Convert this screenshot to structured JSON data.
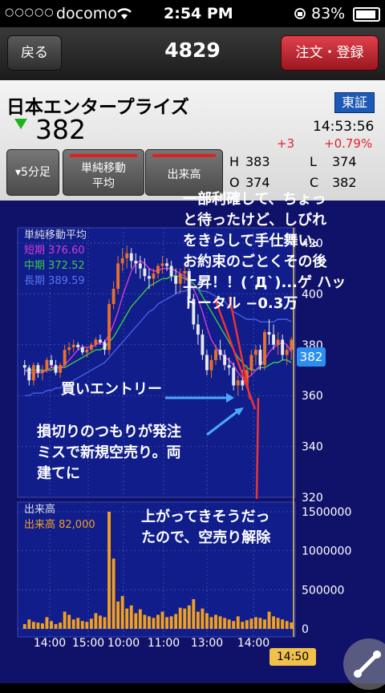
{
  "status_bar": {
    "signal": "○○○○○",
    "carrier": "docomo",
    "time": "2:54 PM",
    "battery": "83%"
  },
  "nav": {
    "back_label": "戻る",
    "title": "4829",
    "order_label": "注文・登録"
  },
  "stock": {
    "name": "日本エンタープライズ",
    "exchange": "東証",
    "price": "382",
    "time": "14:53:56",
    "change": "+3",
    "change_pct": "+0.79%"
  },
  "tabs": {
    "interval": "▾5分足",
    "sma_line1": "単純移動",
    "sma_line2": "平均",
    "volume": "出来高"
  },
  "ohlc": {
    "h_label": "H",
    "h": "383",
    "l_label": "L",
    "l": "374",
    "o_label": "O",
    "o": "374",
    "c_label": "C",
    "c": "382"
  },
  "legend": {
    "title": "単純移動平均",
    "short": "短期 376.60",
    "mid": "中期 372.52",
    "long": "長期 389.59",
    "vol_title": "出来高",
    "vol": "出来高 82,000"
  },
  "colors": {
    "bg": "#10126a",
    "up": "#e8702a",
    "down": "#e8e8e8",
    "short": "#d93ad9",
    "mid": "#3ec94a",
    "long": "#4a5ee0",
    "volume": "#f0a020",
    "annotation_arrow": "#e33",
    "entry_arrow": "#4aa8ff"
  },
  "annotations": {
    "a1": "一部利確して、ちょっ",
    "a2": "と待ったけど、しびれ",
    "a3": "をきらして手仕舞い。",
    "a4": "お約束のごとくその後",
    "a5": "上昇！！(´Д`)...ゲ ハッ",
    "a6": "トータル −0.3万",
    "buy": "買いエントリー",
    "m1": "損切りのつもりが発注",
    "m2": "ミスで新規空売り。両",
    "m3": "建てに",
    "u1": "上がってきそうだっ",
    "u2": "たので、空売り解除"
  },
  "chart_data": {
    "type": "candlestick",
    "price_axis": {
      "ticks": [
        320,
        340,
        360,
        380,
        400,
        420
      ],
      "range": [
        320,
        426
      ]
    },
    "volume_axis": {
      "ticks": [
        0,
        500000,
        1000000,
        1500000
      ],
      "range": [
        0,
        1500000
      ],
      "tick_labels": [
        "0",
        "500000",
        "1000000",
        "1500000"
      ]
    },
    "x_tick_labels": [
      "14:00",
      "15:00",
      "10:00",
      "11:00",
      "13:00",
      "14:00"
    ],
    "last_price": "382",
    "cursor_time": "14:50",
    "candles": [
      [
        372,
        374,
        368,
        371
      ],
      [
        371,
        372,
        364,
        366
      ],
      [
        366,
        373,
        364,
        372
      ],
      [
        372,
        373,
        367,
        369
      ],
      [
        369,
        372,
        366,
        370
      ],
      [
        370,
        375,
        369,
        374
      ],
      [
        374,
        376,
        371,
        372
      ],
      [
        372,
        374,
        368,
        369
      ],
      [
        369,
        373,
        367,
        372
      ],
      [
        372,
        380,
        371,
        378
      ],
      [
        378,
        381,
        376,
        379
      ],
      [
        379,
        382,
        377,
        380
      ],
      [
        380,
        381,
        378,
        379
      ],
      [
        379,
        380,
        376,
        377
      ],
      [
        377,
        379,
        375,
        378
      ],
      [
        378,
        381,
        377,
        380
      ],
      [
        380,
        383,
        379,
        382
      ],
      [
        382,
        384,
        380,
        381
      ],
      [
        381,
        382,
        376,
        378
      ],
      [
        378,
        398,
        376,
        396
      ],
      [
        396,
        405,
        394,
        402
      ],
      [
        402,
        415,
        400,
        412
      ],
      [
        412,
        418,
        409,
        414
      ],
      [
        414,
        419,
        410,
        416
      ],
      [
        416,
        418,
        410,
        413
      ],
      [
        413,
        416,
        408,
        412
      ],
      [
        412,
        415,
        406,
        410
      ],
      [
        410,
        414,
        405,
        407
      ],
      [
        407,
        410,
        402,
        406
      ],
      [
        406,
        410,
        403,
        408
      ],
      [
        408,
        412,
        406,
        411
      ],
      [
        411,
        415,
        408,
        412
      ],
      [
        412,
        414,
        409,
        411
      ],
      [
        411,
        413,
        405,
        407
      ],
      [
        407,
        410,
        400,
        404
      ],
      [
        404,
        410,
        400,
        408
      ],
      [
        408,
        412,
        404,
        409
      ],
      [
        409,
        410,
        395,
        398
      ],
      [
        398,
        400,
        386,
        388
      ],
      [
        388,
        392,
        380,
        384
      ],
      [
        384,
        386,
        374,
        376
      ],
      [
        376,
        378,
        368,
        370
      ],
      [
        370,
        376,
        367,
        374
      ],
      [
        374,
        380,
        372,
        378
      ],
      [
        378,
        382,
        374,
        376
      ],
      [
        376,
        378,
        370,
        372
      ],
      [
        372,
        375,
        368,
        371
      ],
      [
        371,
        373,
        362,
        364
      ],
      [
        364,
        368,
        360,
        366
      ],
      [
        366,
        370,
        362,
        364
      ],
      [
        364,
        372,
        363,
        370
      ],
      [
        370,
        378,
        368,
        376
      ],
      [
        376,
        380,
        372,
        378
      ],
      [
        378,
        380,
        370,
        372
      ],
      [
        372,
        386,
        370,
        385
      ],
      [
        385,
        390,
        380,
        384
      ],
      [
        384,
        388,
        378,
        380
      ],
      [
        380,
        385,
        376,
        382
      ],
      [
        382,
        384,
        374,
        376
      ],
      [
        376,
        380,
        372,
        378
      ],
      [
        378,
        383,
        374,
        382
      ]
    ],
    "sma_short": [
      370,
      369,
      369,
      369,
      369,
      370,
      371,
      371,
      371,
      372,
      374,
      376,
      378,
      379,
      379,
      379,
      380,
      381,
      381,
      384,
      388,
      393,
      399,
      404,
      409,
      412,
      413,
      412,
      410,
      409,
      409,
      410,
      410,
      410,
      409,
      408,
      407,
      405,
      402,
      398,
      393,
      387,
      382,
      379,
      377,
      375,
      374,
      372,
      369,
      367,
      367,
      368,
      370,
      372,
      374,
      377,
      379,
      380,
      381,
      380,
      377
    ],
    "sma_mid": [
      370,
      370,
      370,
      370,
      370,
      370,
      370,
      371,
      371,
      371,
      372,
      373,
      374,
      375,
      376,
      377,
      378,
      378,
      379,
      381,
      383,
      386,
      389,
      392,
      395,
      397,
      399,
      401,
      403,
      404,
      405,
      406,
      406,
      407,
      407,
      407,
      406,
      405,
      404,
      402,
      399,
      396,
      393,
      390,
      387,
      384,
      381,
      378,
      375,
      373,
      371,
      370,
      370,
      371,
      371,
      372,
      373,
      373,
      374,
      374,
      373
    ],
    "sma_long": [
      360,
      360,
      361,
      361,
      361,
      362,
      362,
      363,
      363,
      364,
      365,
      366,
      367,
      368,
      369,
      370,
      371,
      372,
      373,
      375,
      377,
      379,
      381,
      383,
      385,
      387,
      389,
      391,
      393,
      394,
      396,
      397,
      398,
      399,
      400,
      401,
      401,
      402,
      402,
      402,
      401,
      401,
      400,
      399,
      398,
      397,
      395,
      393,
      392,
      391,
      390,
      390,
      390,
      389,
      389,
      389,
      389,
      390,
      390,
      390,
      389
    ],
    "volumes": [
      60000,
      120000,
      90000,
      80000,
      70000,
      150000,
      100000,
      60000,
      80000,
      220000,
      180000,
      120000,
      140000,
      100000,
      90000,
      130000,
      200000,
      170000,
      150000,
      1500000,
      900000,
      350000,
      420000,
      260000,
      300000,
      200000,
      250000,
      180000,
      160000,
      140000,
      180000,
      220000,
      150000,
      160000,
      190000,
      270000,
      260000,
      300000,
      380000,
      220000,
      260000,
      200000,
      150000,
      180000,
      160000,
      140000,
      120000,
      100000,
      160000,
      90000,
      110000,
      130000,
      150000,
      140000,
      120000,
      220000,
      160000,
      140000,
      120000,
      100000,
      82000
    ]
  }
}
